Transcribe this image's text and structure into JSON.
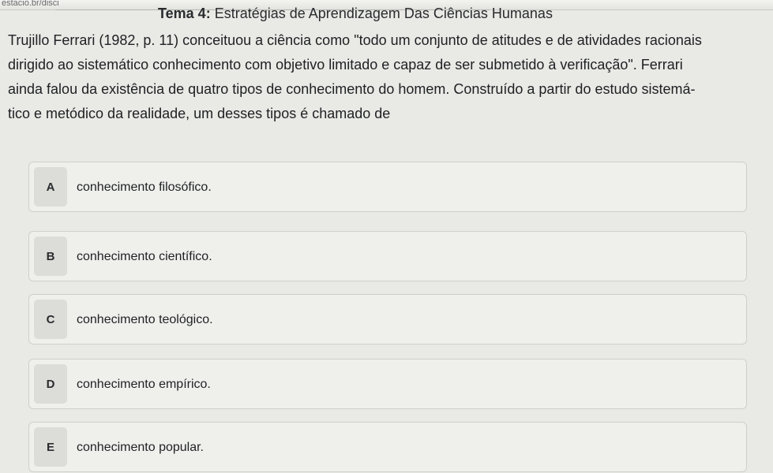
{
  "browser": {
    "url_fragment": "estacio.br/disci"
  },
  "question": {
    "topic_label": "Tema 4:",
    "topic_name": "Estratégias de Aprendizagem Das Ciências Humanas",
    "lines": [
      "Trujillo Ferrari (1982, p. 11) conceituou a ciência como \"todo um conjunto de atitudes e de atividades racionais",
      "dirigido ao sistemático conhecimento com objetivo limitado e capaz de ser submetido à verificação\". Ferrari",
      "ainda falou da existência de quatro tipos de conhecimento do homem. Construído a partir do estudo sistemá-",
      "tico e metódico da realidade, um desses tipos é chamado de"
    ]
  },
  "options": [
    {
      "letter": "A",
      "text": "conhecimento filosófico."
    },
    {
      "letter": "B",
      "text": "conhecimento científico."
    },
    {
      "letter": "C",
      "text": "conhecimento teológico."
    },
    {
      "letter": "D",
      "text": "conhecimento empírico."
    },
    {
      "letter": "E",
      "text": "conhecimento popular."
    }
  ]
}
